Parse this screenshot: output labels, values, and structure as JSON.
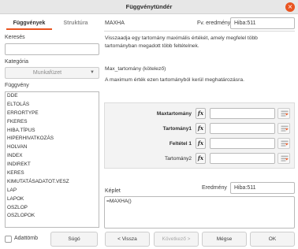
{
  "window": {
    "title": "Függvénytündér"
  },
  "tabs": [
    {
      "label": "Függvények"
    },
    {
      "label": "Struktúra"
    }
  ],
  "search": {
    "label": "Keresés",
    "value": ""
  },
  "category": {
    "label": "Kategória",
    "selected": "Munkafüzet"
  },
  "functions": {
    "label": "Függvény",
    "items": [
      "DDE",
      "ELTOLÁS",
      "ERRORTYPE",
      "FKERES",
      "HIBA.TÍPUS",
      "HIPERHIVATKOZÁS",
      "HOLVAN",
      "INDEX",
      "INDIREKT",
      "KERES",
      "KIMUTATÁSADATOT.VESZ",
      "LAP",
      "LAPOK",
      "OSZLOP",
      "OSZLOPOK"
    ]
  },
  "array_option": {
    "label": "Adattömb",
    "checked": false
  },
  "buttons": {
    "help": "Súgó",
    "back": "< Vissza",
    "next": "Következő >",
    "cancel": "Mégse",
    "ok": "OK"
  },
  "function_info": {
    "name": "MAXHA",
    "result_label": "Fv. eredménye",
    "result_value": "Hiba:511",
    "description": "Visszaadja egy tartomány maximális értékét, amely megfelel több tartományban megadott több feltételnek.",
    "arg_title": "Max_tartomány (kötelező)",
    "arg_description": "A maximum érték ezen tartományból kerül meghatározásra."
  },
  "arguments": [
    {
      "label": "Maxtartomány",
      "bold": true,
      "value": ""
    },
    {
      "label": "Tartomány1",
      "bold": true,
      "value": ""
    },
    {
      "label": "Feltétel 1",
      "bold": true,
      "value": ""
    },
    {
      "label": "Tartomány2",
      "bold": false,
      "value": ""
    }
  ],
  "arg_button_label": "fx",
  "formula": {
    "label": "Képlet",
    "result_label": "Eredmény",
    "result_value": "Hiba:511",
    "text": "=MAXHA()"
  }
}
